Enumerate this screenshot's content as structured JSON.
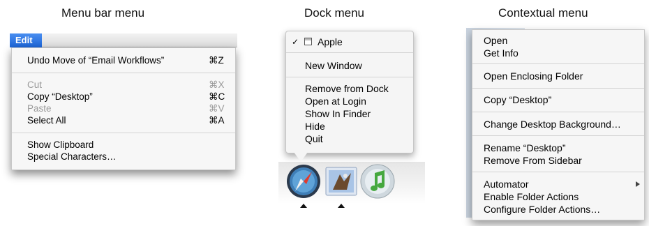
{
  "captions": {
    "menubar": "Menu bar menu",
    "dock": "Dock menu",
    "contextual": "Contextual menu"
  },
  "menubar_menu": {
    "title": "Edit",
    "items": [
      {
        "label": "Undo Move of “Email Workflows”",
        "shortcut": "⌘Z",
        "enabled": true
      },
      {
        "label": "Cut",
        "shortcut": "⌘X",
        "enabled": false
      },
      {
        "label": "Copy “Desktop”",
        "shortcut": "⌘C",
        "enabled": true
      },
      {
        "label": "Paste",
        "shortcut": "⌘V",
        "enabled": false
      },
      {
        "label": "Select All",
        "shortcut": "⌘A",
        "enabled": true
      },
      {
        "label": "Show Clipboard",
        "shortcut": "",
        "enabled": true
      },
      {
        "label": "Special Characters…",
        "shortcut": "",
        "enabled": true
      }
    ]
  },
  "dock_menu": {
    "items": [
      {
        "label": "Apple",
        "checked": true,
        "check": "✓"
      },
      {
        "label": "New Window"
      },
      {
        "label": "Remove from Dock"
      },
      {
        "label": "Open at Login"
      },
      {
        "label": "Show In Finder"
      },
      {
        "label": "Hide"
      },
      {
        "label": "Quit"
      }
    ],
    "dock_icons": [
      "safari-icon",
      "mail-icon",
      "itunes-icon"
    ]
  },
  "contextual_menu": {
    "items": [
      {
        "label": "Open"
      },
      {
        "label": "Get Info"
      },
      {
        "label": "Open Enclosing Folder"
      },
      {
        "label": "Copy “Desktop”"
      },
      {
        "label": "Change Desktop Background…"
      },
      {
        "label": "Rename “Desktop”"
      },
      {
        "label": "Remove From Sidebar"
      },
      {
        "label": "Automator",
        "submenu": true
      },
      {
        "label": "Enable Folder Actions"
      },
      {
        "label": "Configure Folder Actions…"
      }
    ]
  }
}
